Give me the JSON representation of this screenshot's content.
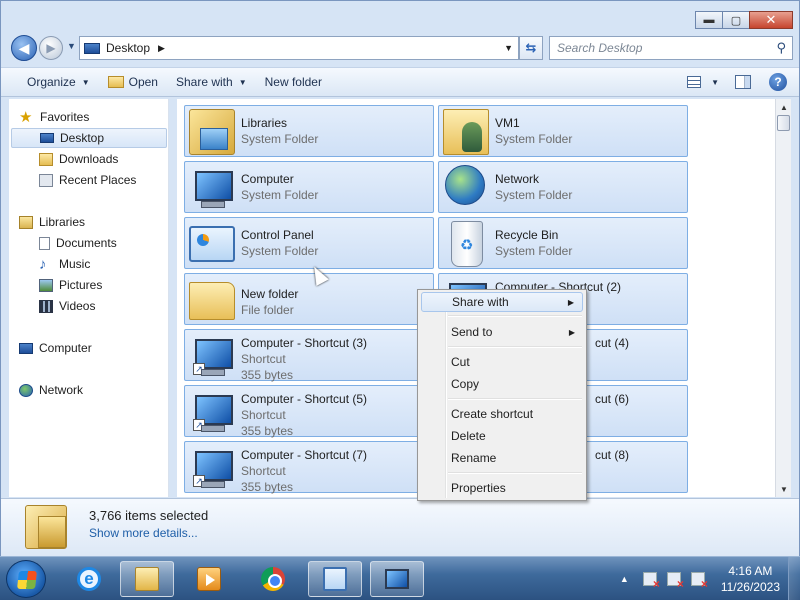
{
  "window": {
    "caption_buttons": {
      "minimize": "▬",
      "maximize": "▢",
      "close": "✕"
    }
  },
  "address": {
    "current": "Desktop",
    "search_placeholder": "Search Desktop"
  },
  "toolbar": {
    "organize": "Organize",
    "open": "Open",
    "share_with": "Share with",
    "new_folder": "New folder"
  },
  "nav": {
    "favorites": "Favorites",
    "desktop": "Desktop",
    "downloads": "Downloads",
    "recent_places": "Recent Places",
    "libraries": "Libraries",
    "documents": "Documents",
    "music": "Music",
    "pictures": "Pictures",
    "videos": "Videos",
    "computer": "Computer",
    "network": "Network"
  },
  "items": [
    {
      "name": "Libraries",
      "type": "System Folder"
    },
    {
      "name": "VM1",
      "type": "System Folder"
    },
    {
      "name": "Computer",
      "type": "System Folder"
    },
    {
      "name": "Network",
      "type": "System Folder"
    },
    {
      "name": "Control Panel",
      "type": "System Folder"
    },
    {
      "name": "Recycle Bin",
      "type": "System Folder"
    },
    {
      "name": "New folder",
      "type": "File folder"
    },
    {
      "name": "Computer - Shortcut (2)",
      "type": "",
      "size": ""
    },
    {
      "name": "Computer - Shortcut (3)",
      "type": "Shortcut",
      "size": "355 bytes"
    },
    {
      "name": "cut (4)"
    },
    {
      "name": "Computer - Shortcut (5)",
      "type": "Shortcut",
      "size": "355 bytes"
    },
    {
      "name": "cut (6)"
    },
    {
      "name": "Computer - Shortcut (7)",
      "type": "Shortcut",
      "size": "355 bytes"
    },
    {
      "name": "cut (8)"
    }
  ],
  "details": {
    "count": "3,766 items selected",
    "more": "Show more details..."
  },
  "context_menu": {
    "share_with": "Share with",
    "send_to": "Send to",
    "cut": "Cut",
    "copy": "Copy",
    "create_shortcut": "Create shortcut",
    "delete": "Delete",
    "rename": "Rename",
    "properties": "Properties"
  },
  "taskbar": {
    "time": "4:16 AM",
    "date": "11/26/2023"
  },
  "colors": {
    "selection_fill": "#cfe0f6",
    "selection_border": "#7eaee4",
    "link": "#1f5fa8",
    "taskbar": "#3e6a9c"
  }
}
